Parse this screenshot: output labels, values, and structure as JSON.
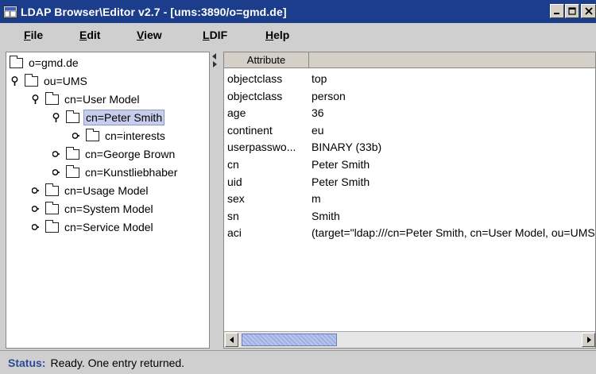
{
  "window": {
    "title": "LDAP Browser\\Editor v2.7 - [ums:3890/o=gmd.de]"
  },
  "menu": [
    {
      "label": "File",
      "mnemonic": "F",
      "rest": "ile"
    },
    {
      "label": "Edit",
      "mnemonic": "E",
      "rest": "dit"
    },
    {
      "label": "View",
      "mnemonic": "V",
      "rest": "iew"
    },
    {
      "label": "LDIF",
      "mnemonic": "L",
      "rest": "DIF"
    },
    {
      "label": "Help",
      "mnemonic": "H",
      "rest": "elp"
    }
  ],
  "tree": [
    {
      "label": "o=gmd.de",
      "handle": "none"
    },
    {
      "label": "ou=UMS",
      "handle": "expanded"
    },
    {
      "label": "cn=User Model",
      "handle": "expanded"
    },
    {
      "label": "cn=Peter Smith",
      "handle": "expanded",
      "selected": true
    },
    {
      "label": "cn=interests",
      "handle": "collapsed"
    },
    {
      "label": "cn=George Brown",
      "handle": "collapsed"
    },
    {
      "label": "cn=Kunstliebhaber",
      "handle": "collapsed"
    },
    {
      "label": "cn=Usage Model",
      "handle": "collapsed"
    },
    {
      "label": "cn=System Model",
      "handle": "collapsed"
    },
    {
      "label": "cn=Service Model",
      "handle": "collapsed"
    }
  ],
  "table": {
    "columns": [
      "Attribute",
      ""
    ],
    "rows": [
      {
        "attr": "objectclass",
        "value": "top"
      },
      {
        "attr": "objectclass",
        "value": "person"
      },
      {
        "attr": "age",
        "value": "36"
      },
      {
        "attr": "continent",
        "value": "eu"
      },
      {
        "attr": "userpasswo...",
        "value": "BINARY (33b)"
      },
      {
        "attr": "cn",
        "value": "Peter Smith"
      },
      {
        "attr": "uid",
        "value": "Peter Smith"
      },
      {
        "attr": "sex",
        "value": "m"
      },
      {
        "attr": "sn",
        "value": "Smith"
      },
      {
        "attr": "aci",
        "value": "(target=\"ldap:///cn=Peter Smith, cn=User Model, ou=UMS"
      }
    ]
  },
  "status": {
    "label": "Status:",
    "text": "Ready. One entry returned."
  },
  "icons": {
    "app": "app-icon",
    "minimize": "minimize-icon",
    "maximize": "maximize-icon",
    "close": "close-icon",
    "folder": "folder-icon",
    "expanded": "handle-expanded-icon",
    "collapsed": "handle-collapsed-icon"
  },
  "colors": {
    "titlebar": "#1c3c8c",
    "selection": "#c7cdea",
    "status_label": "#2a4a98"
  }
}
